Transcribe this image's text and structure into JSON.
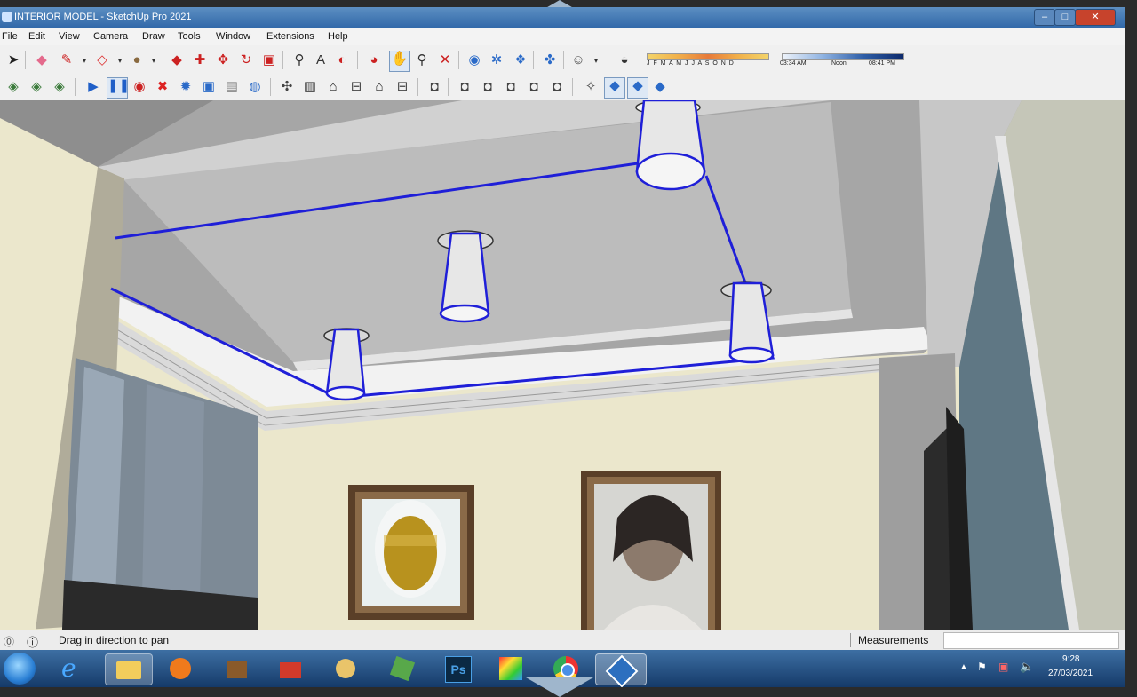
{
  "window": {
    "title": "INTERIOR MODEL - SketchUp Pro 2021",
    "minimize_glyph": "–",
    "maximize_glyph": "□",
    "close_glyph": "✕"
  },
  "menu": [
    "File",
    "Edit",
    "View",
    "Camera",
    "Draw",
    "Tools",
    "Window",
    "Extensions",
    "Help"
  ],
  "shadow_panel": {
    "months_label": "J F M A M J J A S O N D",
    "time_start": "03:34 AM",
    "time_noon": "Noon",
    "time_end": "08:41 PM"
  },
  "toolbar1_icons": [
    "select-arrow-icon",
    "eraser-icon",
    "pencil-icon",
    "shape-tool-icon",
    "paint-bucket-icon",
    "push-pull-icon",
    "move-icon",
    "rotate-icon",
    "scale-icon",
    "follow-me-icon",
    "tape-measure-icon",
    "text-icon",
    "orbit-icon",
    "pan-icon",
    "zoom-icon",
    "zoom-extents-icon",
    "geo-location-icon",
    "section-icon",
    "component-icon",
    "styles-icon",
    "user-icon",
    "shadow-icon"
  ],
  "toolbar2_icons": [
    "sandbox-icon",
    "stamp-icon",
    "drape-icon",
    "play-icon",
    "pause-icon",
    "record-icon",
    "stop-icon",
    "gear-icon",
    "scene-icon",
    "export-icon",
    "help-circle-icon",
    "iso-view-icon",
    "top-view-icon",
    "front-view-icon",
    "right-view-icon",
    "back-view-icon",
    "left-view-icon",
    "xray-icon",
    "wireframe-icon",
    "hidden-line-icon",
    "shaded-icon",
    "textured-icon",
    "monochrome-icon",
    "axes-icon",
    "layer-solid-icon",
    "layer-fill-icon",
    "layer-edge-icon"
  ],
  "status": {
    "message": "Drag in direction to pan",
    "measurements_label": "Measurements",
    "measurements_value": ""
  },
  "taskbar": {
    "apps": [
      "start-orb-icon",
      "internet-explorer-icon",
      "file-explorer-icon",
      "media-player-icon",
      "archive-icon",
      "toolbox-icon",
      "paint-icon",
      "photo-editor-icon",
      "photoshop-icon",
      "color-picker-icon",
      "chrome-icon",
      "sketchup-icon"
    ],
    "photoshop_label": "Ps",
    "time": "9:28",
    "date": "27/03/2021"
  },
  "colors": {
    "selection_blue": "#1f1fd8",
    "ceiling": "#b9b9b9",
    "wall": "#ece8cc"
  }
}
